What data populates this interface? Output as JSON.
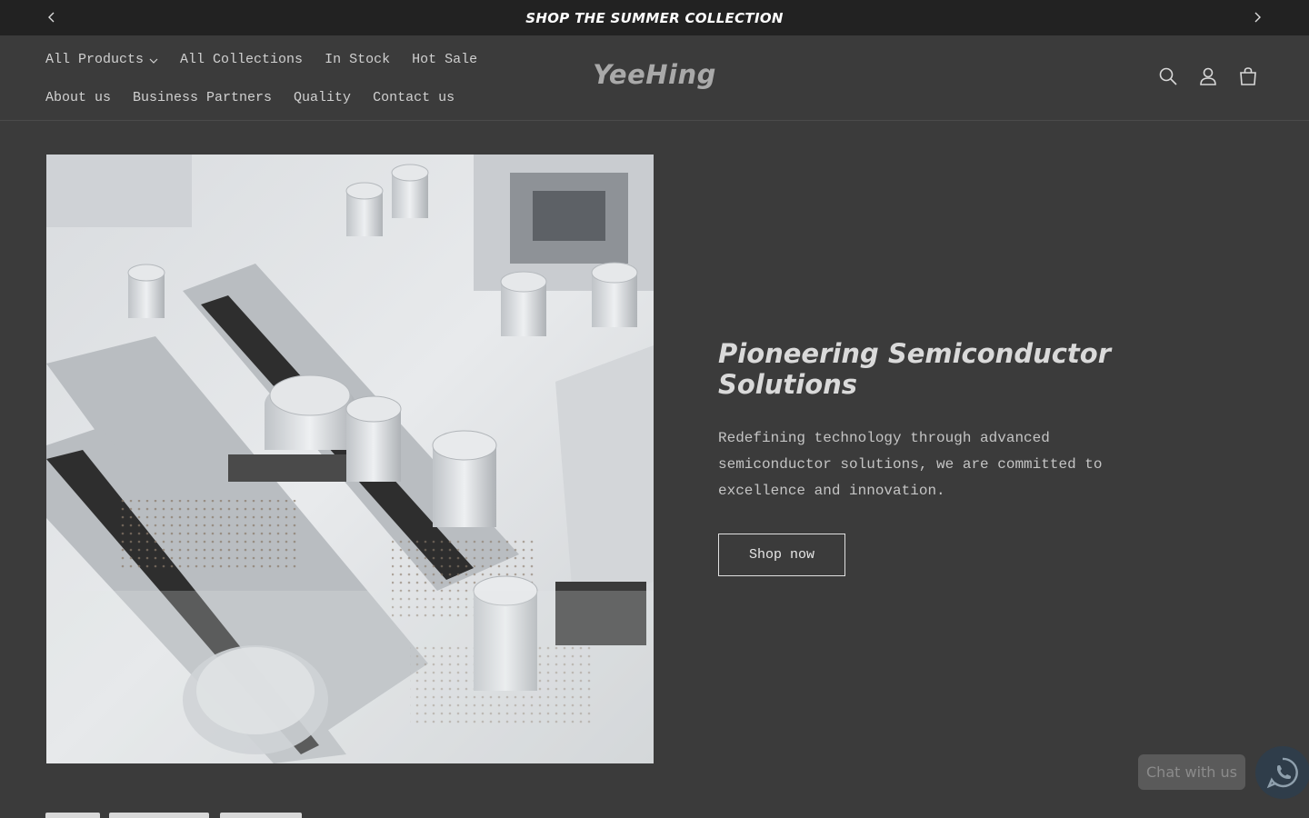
{
  "announcement": {
    "text": "SHOP THE SUMMER COLLECTION",
    "prev_icon": "chevron-left-icon",
    "next_icon": "chevron-right-icon"
  },
  "nav": {
    "row1": [
      {
        "label": "All Products",
        "has_dropdown": true
      },
      {
        "label": "All Collections"
      },
      {
        "label": "In Stock"
      },
      {
        "label": "Hot Sale"
      }
    ],
    "row2": [
      {
        "label": "About us"
      },
      {
        "label": "Business Partners"
      },
      {
        "label": "Quality"
      },
      {
        "label": "Contact us"
      }
    ]
  },
  "brand": {
    "logo_text": "YeeHing"
  },
  "header_icons": [
    "search-icon",
    "account-icon",
    "cart-icon"
  ],
  "hero": {
    "title": "Pioneering Semiconductor Solutions",
    "text": "Redefining technology through advanced semiconductor solutions, we are committed to excellence and innovation.",
    "button_label": "Shop now"
  },
  "chat": {
    "label": "Chat with us",
    "icon": "whatsapp-icon"
  },
  "colors": {
    "page_background": "#3b3b3b",
    "announcement_background": "#222222",
    "chat_circle": "#2f3d4a"
  }
}
